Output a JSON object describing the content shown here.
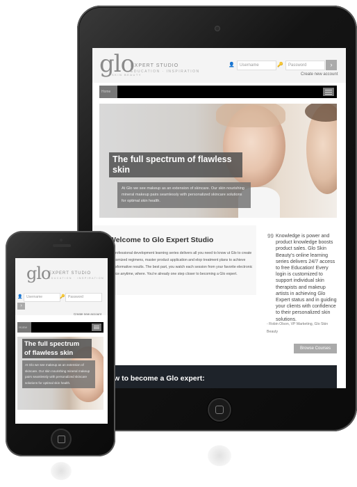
{
  "brand": {
    "logo": "glo",
    "logo_tagline": "SKIN BEAUTY",
    "name": "EXPERT STUDIO",
    "tagline": "EDUCATION · INSPIRATION"
  },
  "login": {
    "username_placeholder": "Username",
    "password_placeholder": "Password",
    "go_label": "›",
    "create_account": "Create new account"
  },
  "nav": {
    "home": "Home"
  },
  "hero": {
    "title_line1": "The full spectrum of flawless",
    "title_line2": "skin",
    "text": "At Glo we see makeup as an extension of skincare. Our skin nourishing mineral makeup pairs seamlessly with personalized skincare solutions for optimal skin health."
  },
  "phone_hero": {
    "title_line1": "The full spectrum",
    "title_line2": "of flawless skin",
    "text": "At Glo we see makeup as an extension of skincare. Our skin nourishing mineral makeup pairs seamlessly with personalized skincare solutions for optimal skin health."
  },
  "welcome": {
    "title": "Welcome to Glo Expert Studio",
    "body": "ur professional development learning series delivers all you need to know ut Glo to create customized regimens, master product application and elop treatment plans to achieve transformative results. The best part, you watch each session from your favorite electronic device anytime, where. You're already one step closer to becoming a Glo expert."
  },
  "quote": {
    "mark": "99",
    "text": "Knowledge is power and product knowledge boosts product sales. Glo Skin Beauty's online learning series delivers 24/7 access to free Education! Every login is customized to support individual skin therapists and makeup artists in achieving Glo Expert status and in guiding your clients with confidence to their personalized skin solutions.",
    "author": "- Robin Olson, VP Marketing, Glo Skin Beauty"
  },
  "cta": {
    "browse": "Browse Courses"
  },
  "band": {
    "title": "w to become a Glo expert:"
  },
  "colors": {
    "device_bezel": "#111111",
    "nav_black": "#000000",
    "button_gray": "#aaaaaa",
    "dark_band": "#1e232a"
  }
}
